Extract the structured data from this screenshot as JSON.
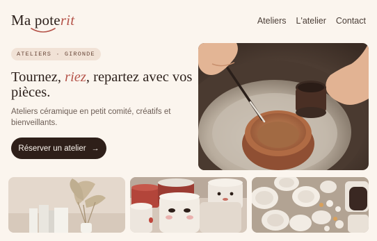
{
  "logo": {
    "text_main": "Ma pote",
    "text_accent": "rit"
  },
  "nav": {
    "items": [
      "Ateliers",
      "L'atelier",
      "Contact"
    ]
  },
  "hero": {
    "badge": "ATELIERS · GIRONDE",
    "headline_part1": "Tournez, ",
    "headline_em": "riez",
    "headline_part2": ", repartez avec vos pièces.",
    "subtitle": "Ateliers céramique en petit comité, créatifs et bienveillants.",
    "cta_label": "Réserver un atelier",
    "cta_icon": "arrow-right-icon"
  },
  "colors": {
    "background": "#fbf5ee",
    "accent": "#b5544a",
    "dark": "#2e1f19",
    "badge_bg": "#f1e2d6"
  }
}
